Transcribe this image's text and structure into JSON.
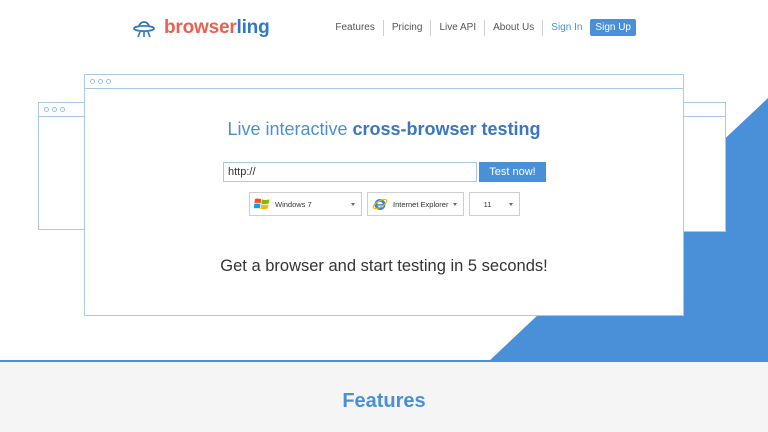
{
  "brand": {
    "name_part1": "browser",
    "name_part2": "ling",
    "logo_icon": "ufo-icon",
    "colors": {
      "red": "#ea6153",
      "blue": "#2f78c4",
      "accent": "#4a90d9"
    }
  },
  "nav": {
    "items": [
      "Features",
      "Pricing",
      "Live API",
      "About Us"
    ],
    "sign_in": "Sign In",
    "sign_up": "Sign Up"
  },
  "hero": {
    "title_plain": "Live interactive ",
    "title_bold": "cross-browser testing",
    "url_value": "http://",
    "test_button": "Test now!",
    "os_select": {
      "value": "Windows 7",
      "icon": "windows-icon"
    },
    "browser_select": {
      "value": "Internet Explorer",
      "icon": "internet-explorer-icon"
    },
    "version_select": {
      "value": "11"
    },
    "subtitle": "Get a browser and start testing in 5 seconds!"
  },
  "features": {
    "title": "Features"
  }
}
